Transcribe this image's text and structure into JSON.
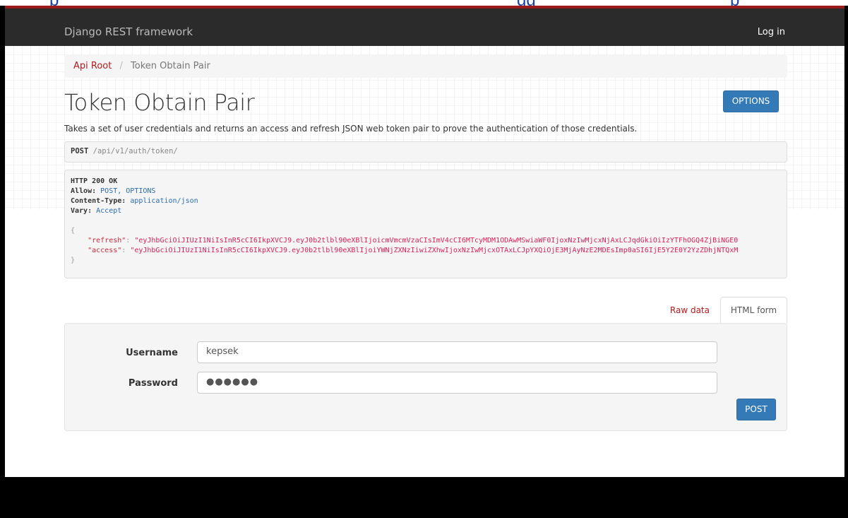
{
  "navbar": {
    "brand": "Django REST framework",
    "login": "Log in"
  },
  "breadcrumb": {
    "root": "Api Root",
    "separator": "/",
    "current": "Token Obtain Pair"
  },
  "page": {
    "title": "Token Obtain Pair",
    "options_button": "OPTIONS",
    "description": "Takes a set of user credentials and returns an access and refresh JSON web token pair to prove the authentication of those credentials."
  },
  "request": {
    "method": "POST",
    "path": "/api/v1/auth/token/"
  },
  "response": {
    "status": "HTTP 200 OK",
    "headers": [
      {
        "name": "Allow:",
        "value": "POST, OPTIONS"
      },
      {
        "name": "Content-Type:",
        "value": "application/json"
      },
      {
        "name": "Vary:",
        "value": "Accept"
      }
    ],
    "open_brace": "{",
    "close_brace": "}",
    "refresh_key": "\"refresh\"",
    "refresh_value": "\"eyJhbGciOiJIUzI1NiIsInR5cCI6IkpXVCJ9.eyJ0b2tlbl90eXBlIjoicmVmcmVzaCIsImV4cCI6MTcyMDM1ODAwMSwiaWF0IjoxNzIwMjcxNjAxLCJqdGkiOiIzYTFhOGQ4ZjBiNGE0",
    "access_key": "\"access\"",
    "access_value": "\"eyJhbGciOiJIUzI1NiIsInR5cCI6IkpXVCJ9.eyJ0b2tlbl90eXBlIjoiYWNjZXNzIiwiZXhwIjoxNzIwMjcxOTAxLCJpYXQiOjE3MjAyNzE2MDEsImp0aSI6IjE5Y2E0Y2YzZDhjNTQxM"
  },
  "tabs": {
    "raw": "Raw data",
    "html": "HTML form"
  },
  "form": {
    "username_label": "Username",
    "username_value": "kepsek",
    "password_label": "Password",
    "password_value": "●●●●●●",
    "post_button": "POST"
  },
  "top_crop_text": "p                                                                                 gg                                    p"
}
